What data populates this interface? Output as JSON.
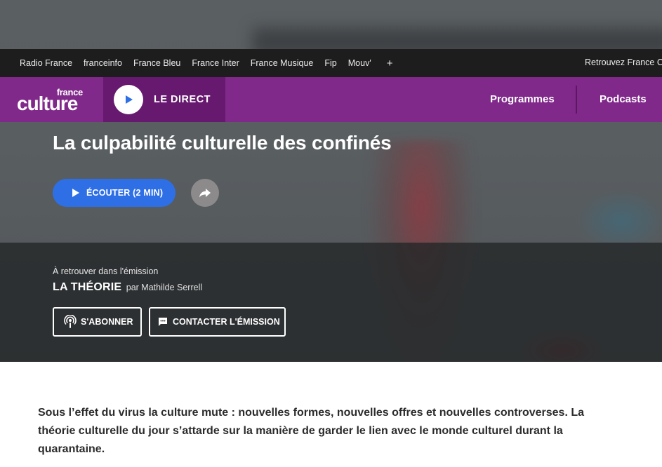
{
  "network_bar": {
    "links": [
      "Radio France",
      "franceinfo",
      "France Bleu",
      "France Inter",
      "France Musique",
      "Fip",
      "Mouv'"
    ],
    "more": "+",
    "retrouvez": "Retrouvez France Cu"
  },
  "header": {
    "logo_small": "france",
    "logo_big": "culture",
    "direct_label": "LE DIRECT",
    "nav": {
      "programmes": "Programmes",
      "podcasts": "Podcasts"
    }
  },
  "article": {
    "title": "La culpabilité culturelle des confinés",
    "listen_label": "ÉCOUTER (2 MIN)",
    "lead": "Sous l’effet du virus la culture mute : nouvelles formes, nouvelles offres et nouvelles controverses. La théorie culturelle du jour s’attarde sur la manière de garder le lien avec le monde culturel durant la quarantaine."
  },
  "emission": {
    "retrouver": "À retrouver dans l'émission",
    "name": "LA THÉORIE",
    "par": "par Mathilde Serrell",
    "subscribe_label": "S'ABONNER",
    "contact_label": "CONTACTER L'ÉMISSION"
  },
  "colors": {
    "brand_purple": "#80298a",
    "direct_purple": "#66196e",
    "listen_blue": "#2f6fe6",
    "network_bar": "#1d1d1d"
  },
  "icons": {
    "play": "play-icon",
    "share": "share-icon",
    "podcast": "podcast-icon",
    "chat": "chat-icon"
  }
}
